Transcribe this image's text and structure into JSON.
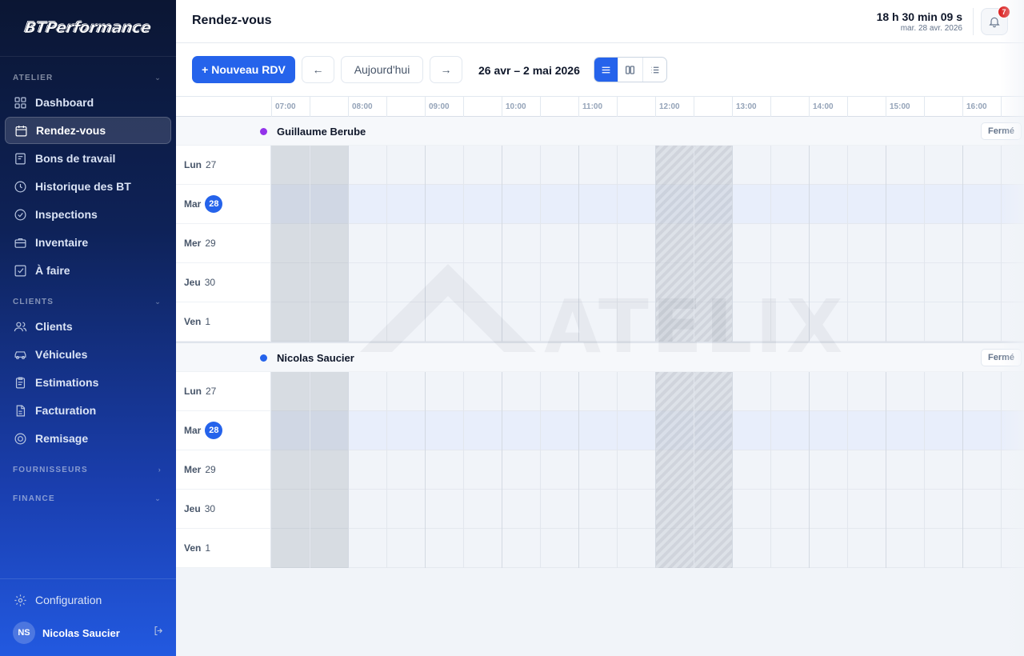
{
  "brand": {
    "logo_text": "BTPerformance"
  },
  "sidebar": {
    "sections": {
      "atelier": "ATELIER",
      "clients": "CLIENTS",
      "fournisseurs": "FOURNISSEURS",
      "finance": "FINANCE"
    },
    "items": [
      {
        "label": "Dashboard",
        "icon": "grid-icon"
      },
      {
        "label": "Rendez-vous",
        "icon": "calendar-icon",
        "active": true
      },
      {
        "label": "Bons de travail",
        "icon": "document-icon"
      },
      {
        "label": "Historique des BT",
        "icon": "clock-icon"
      },
      {
        "label": "Inspections",
        "icon": "check-circle-icon"
      },
      {
        "label": "Inventaire",
        "icon": "briefcase-icon"
      },
      {
        "label": "À faire",
        "icon": "checkbox-icon"
      },
      {
        "label": "Clients",
        "icon": "users-icon"
      },
      {
        "label": "Véhicules",
        "icon": "car-icon"
      },
      {
        "label": "Estimations",
        "icon": "clipboard-icon"
      },
      {
        "label": "Facturation",
        "icon": "file-icon"
      },
      {
        "label": "Remisage",
        "icon": "tire-icon"
      }
    ],
    "config_label": "Configuration",
    "user": {
      "initials": "NS",
      "name": "Nicolas Saucier"
    }
  },
  "header": {
    "title": "Rendez-vous",
    "clock_time": "18 h 30 min 09 s",
    "clock_date": "mar. 28 avr. 2026",
    "notification_count": "7"
  },
  "toolbar": {
    "new_button": "+ Nouveau RDV",
    "prev": "←",
    "today": "Aujourd'hui",
    "next": "→",
    "range": "26 avr – 2 mai 2026",
    "views": [
      "list-view-icon",
      "columns-view-icon",
      "bullets-view-icon"
    ],
    "active_view": 0
  },
  "schedule": {
    "hours": [
      "07:00",
      "08:00",
      "09:00",
      "10:00",
      "11:00",
      "12:00",
      "13:00",
      "14:00",
      "15:00",
      "16:00"
    ],
    "technicians": [
      {
        "name": "Guillaume Berube",
        "color": "#9333ea",
        "status": "Fermé",
        "days": [
          {
            "name": "Lun",
            "num": "27"
          },
          {
            "name": "Mar",
            "num": "28",
            "today": true
          },
          {
            "name": "Mer",
            "num": "29"
          },
          {
            "name": "Jeu",
            "num": "30"
          },
          {
            "name": "Ven",
            "num": "1"
          }
        ]
      },
      {
        "name": "Nicolas Saucier",
        "color": "#2563eb",
        "status": "Fermé",
        "days": [
          {
            "name": "Lun",
            "num": "27"
          },
          {
            "name": "Mar",
            "num": "28",
            "today": true
          },
          {
            "name": "Mer",
            "num": "29"
          },
          {
            "name": "Jeu",
            "num": "30"
          },
          {
            "name": "Ven",
            "num": "1"
          }
        ]
      }
    ]
  },
  "watermark": "ATELIX"
}
